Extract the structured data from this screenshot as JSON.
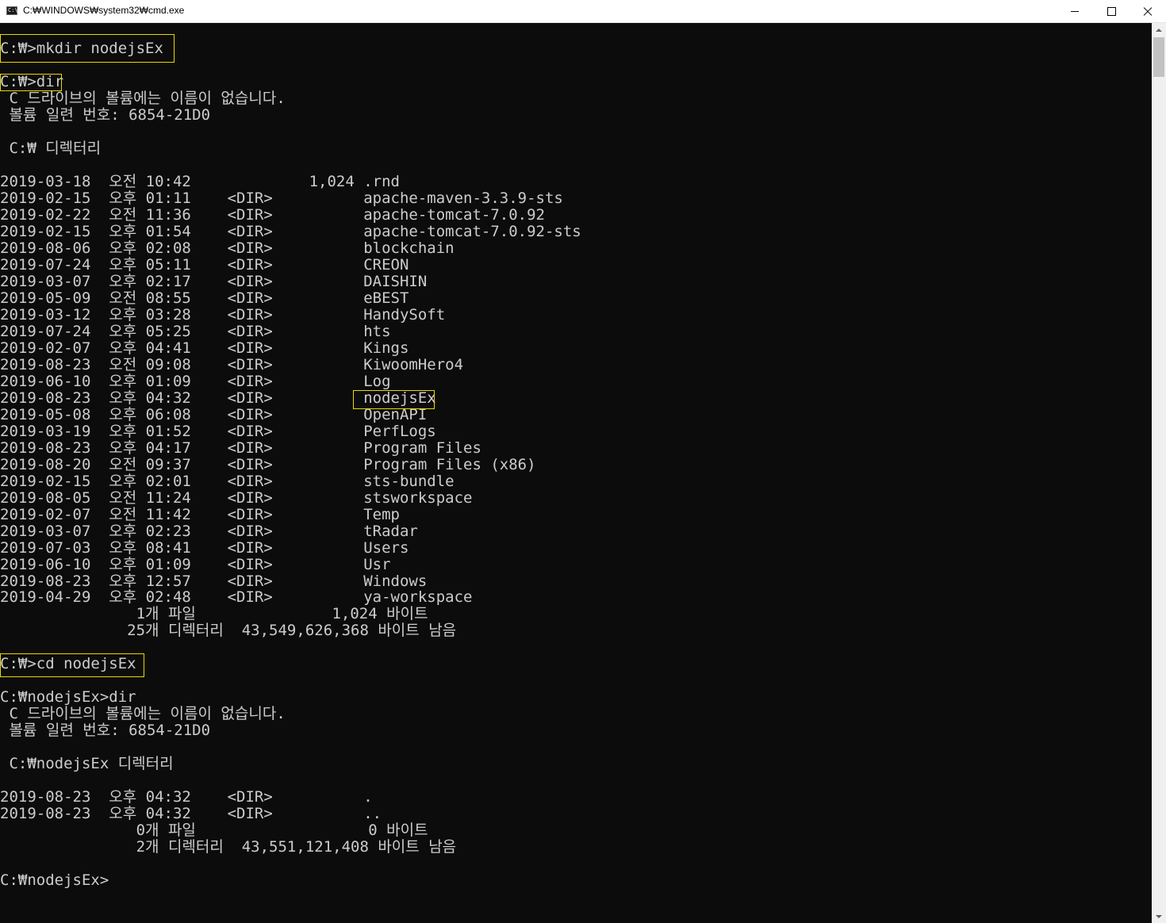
{
  "window": {
    "title": "C:₩WINDOWS₩system32₩cmd.exe",
    "icon_text": "C:\\",
    "icon": "cmd-icon",
    "controls": [
      "minimize-icon",
      "maximize-icon",
      "close-icon"
    ]
  },
  "colors": {
    "background": "#0c0c0c",
    "text": "#cccccc",
    "highlight_box": "#e8d800"
  },
  "console": {
    "lines": [
      "C:₩>mkdir nodejsEx",
      "",
      "C:₩>dir",
      " C 드라이브의 볼륨에는 이름이 없습니다.",
      " 볼륨 일련 번호: 6854-21D0",
      "",
      " C:₩ 디렉터리",
      "",
      "2019-03-18  오전 10:42             1,024 .rnd",
      "2019-02-15  오후 01:11    <DIR>          apache-maven-3.3.9-sts",
      "2019-02-22  오전 11:36    <DIR>          apache-tomcat-7.0.92",
      "2019-02-15  오후 01:54    <DIR>          apache-tomcat-7.0.92-sts",
      "2019-08-06  오후 02:08    <DIR>          blockchain",
      "2019-07-24  오후 05:11    <DIR>          CREON",
      "2019-03-07  오후 02:17    <DIR>          DAISHIN",
      "2019-05-09  오전 08:55    <DIR>          eBEST",
      "2019-03-12  오후 03:28    <DIR>          HandySoft",
      "2019-07-24  오후 05:25    <DIR>          hts",
      "2019-02-07  오후 04:41    <DIR>          Kings",
      "2019-08-23  오전 09:08    <DIR>          KiwoomHero4",
      "2019-06-10  오후 01:09    <DIR>          Log",
      "2019-08-23  오후 04:32    <DIR>          nodejsEx",
      "2019-05-08  오후 06:08    <DIR>          OpenAPI",
      "2019-03-19  오후 01:52    <DIR>          PerfLogs",
      "2019-08-23  오후 04:17    <DIR>          Program Files",
      "2019-08-20  오전 09:37    <DIR>          Program Files (x86)",
      "2019-02-15  오후 02:01    <DIR>          sts-bundle",
      "2019-08-05  오전 11:24    <DIR>          stsworkspace",
      "2019-02-07  오전 11:42    <DIR>          Temp",
      "2019-03-07  오후 02:23    <DIR>          tRadar",
      "2019-07-03  오후 08:41    <DIR>          Users",
      "2019-06-10  오후 01:09    <DIR>          Usr",
      "2019-08-23  오후 12:57    <DIR>          Windows",
      "2019-04-29  오후 02:48    <DIR>          ya-workspace",
      "               1개 파일               1,024 바이트",
      "              25개 디렉터리  43,549,626,368 바이트 남음",
      "",
      "C:₩>cd nodejsEx",
      "",
      "C:₩nodejsEx>dir",
      " C 드라이브의 볼륨에는 이름이 없습니다.",
      " 볼륨 일련 번호: 6854-21D0",
      "",
      " C:₩nodejsEx 디렉터리",
      "",
      "2019-08-23  오후 04:32    <DIR>          .",
      "2019-08-23  오후 04:32    <DIR>          ..",
      "               0개 파일                   0 바이트",
      "               2개 디렉터리  43,551,121,408 바이트 남음",
      "",
      "C:₩nodejsEx>"
    ]
  }
}
